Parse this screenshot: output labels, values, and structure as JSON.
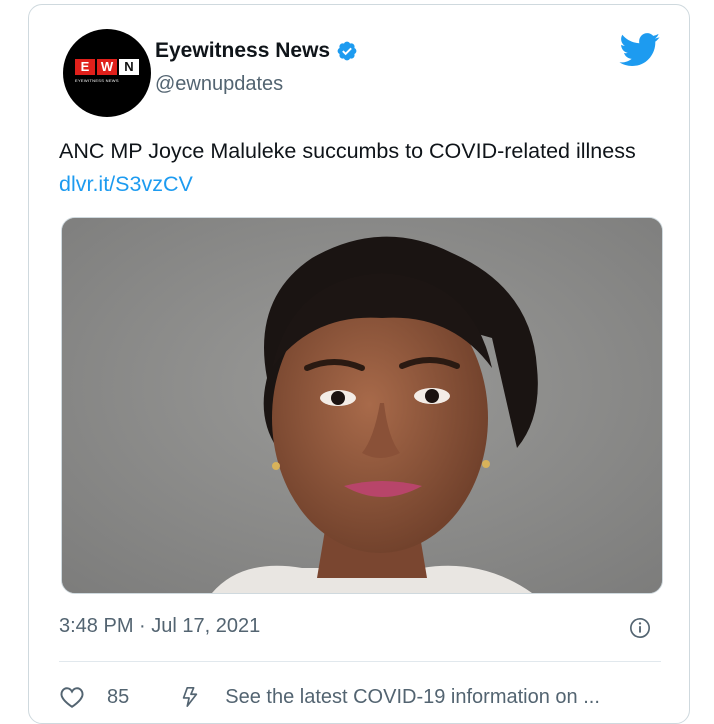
{
  "author": {
    "display_name": "Eyewitness News",
    "handle": "@ewnupdates",
    "verified": true,
    "avatar_logo": {
      "letters": [
        "E",
        "W",
        "N"
      ],
      "subtitle": "EYEWITNESS NEWS"
    }
  },
  "tweet": {
    "text": "ANC MP Joyce Maluleke succumbs to COVID-related illness ",
    "link_text": "dlvr.it/S3vzCV",
    "timestamp": "3:48 PM · Jul 17, 2021"
  },
  "actions": {
    "like_count": "85",
    "covid_notice": "See the latest COVID-19 information on ..."
  },
  "icons": {
    "brand": "twitter-bird-icon",
    "verified": "verified-badge-icon",
    "info": "info-icon",
    "like": "heart-icon",
    "covid": "lightning-icon"
  },
  "colors": {
    "link": "#1d9bf0",
    "text": "#0f1419",
    "secondary": "#536471",
    "brand_red": "#e0201b"
  }
}
